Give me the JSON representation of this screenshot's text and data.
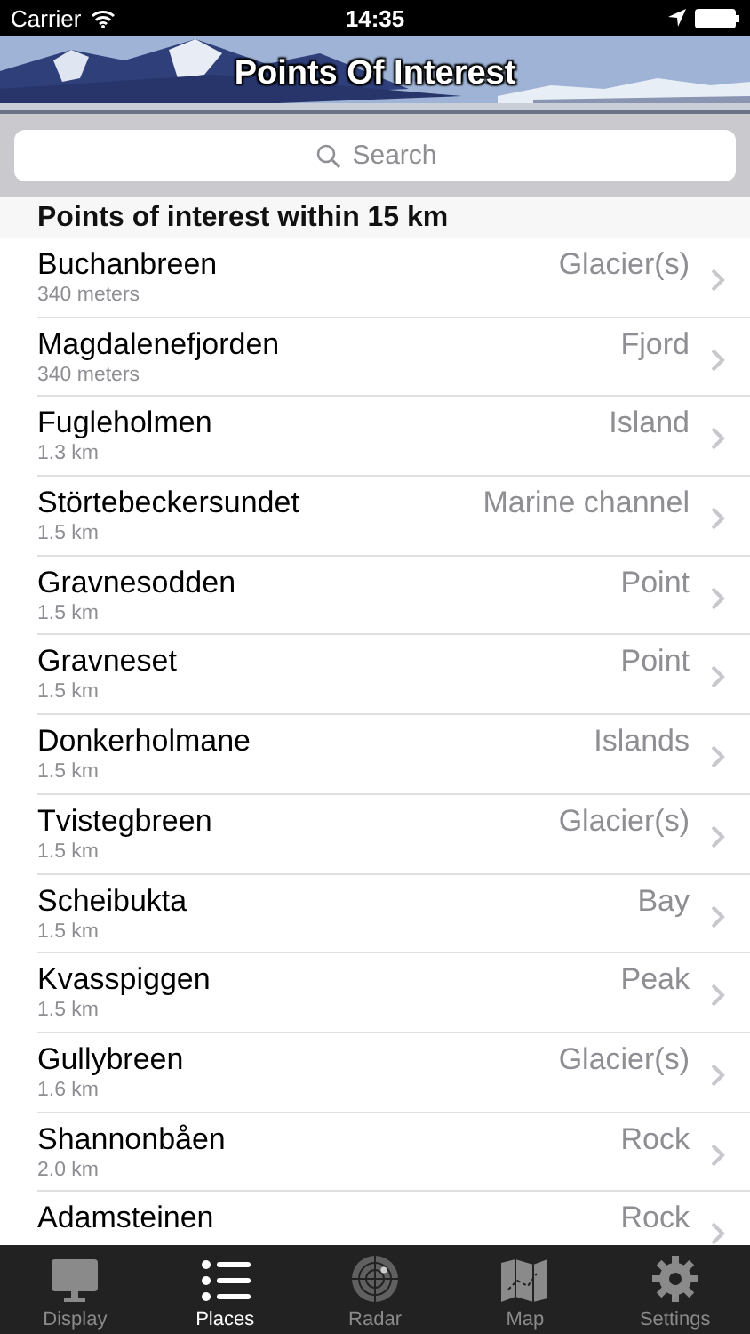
{
  "status_bar": {
    "carrier": "Carrier",
    "time": "14:35"
  },
  "header": {
    "title": "Points Of Interest"
  },
  "search": {
    "placeholder": "Search"
  },
  "section": {
    "title": "Points of interest within 15 km"
  },
  "rows": [
    {
      "name": "Buchanbreen",
      "distance": "340 meters",
      "type": "Glacier(s)"
    },
    {
      "name": "Magdalenefjorden",
      "distance": "340 meters",
      "type": "Fjord"
    },
    {
      "name": "Fugleholmen",
      "distance": "1.3 km",
      "type": "Island"
    },
    {
      "name": "Störtebeckersundet",
      "distance": "1.5 km",
      "type": "Marine channel"
    },
    {
      "name": "Gravnesodden",
      "distance": "1.5 km",
      "type": "Point"
    },
    {
      "name": "Gravneset",
      "distance": "1.5 km",
      "type": "Point"
    },
    {
      "name": "Donkerholmane",
      "distance": "1.5 km",
      "type": "Islands"
    },
    {
      "name": "Tvistegbreen",
      "distance": "1.5 km",
      "type": "Glacier(s)"
    },
    {
      "name": "Scheibukta",
      "distance": "1.5 km",
      "type": "Bay"
    },
    {
      "name": "Kvasspiggen",
      "distance": "1.5 km",
      "type": "Peak"
    },
    {
      "name": "Gullybreen",
      "distance": "1.6 km",
      "type": "Glacier(s)"
    },
    {
      "name": "Shannonbåen",
      "distance": "2.0 km",
      "type": "Rock"
    },
    {
      "name": "Adamsteinen",
      "type": "Rock"
    }
  ],
  "tabs": [
    {
      "label": "Display",
      "kind": "display",
      "selected": false
    },
    {
      "label": "Places",
      "kind": "places",
      "selected": true
    },
    {
      "label": "Radar",
      "kind": "radar",
      "selected": false
    },
    {
      "label": "Map",
      "kind": "map",
      "selected": false
    },
    {
      "label": "Settings",
      "kind": "settings",
      "selected": false
    }
  ]
}
